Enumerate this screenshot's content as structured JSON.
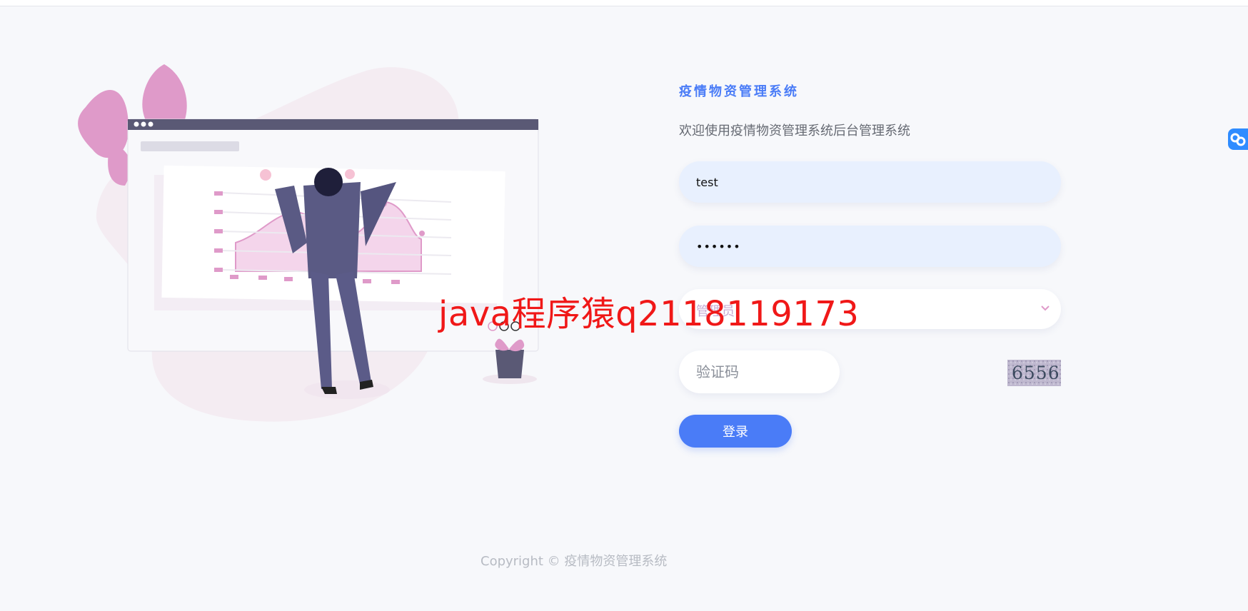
{
  "app": {
    "title": "疫情物资管理系统",
    "subtitle": "欢迎使用疫情物资管理系统后台管理系统"
  },
  "form": {
    "username_value": "test",
    "password_value": "••••••",
    "role_value": "管理员",
    "captcha_placeholder": "验证码",
    "captcha_code": "6556",
    "login_label": "登录"
  },
  "watermark": {
    "text": "java程序猿q2118119173"
  },
  "footer": {
    "copyright": "Copyright © 疫情物资管理系统"
  },
  "icons": {
    "side_tool": "link-icon",
    "select_arrow": "chevron-down-icon"
  },
  "colors": {
    "primary": "#4a7cf7",
    "accent_pink": "#df9ac9",
    "watermark": "#f01818"
  }
}
